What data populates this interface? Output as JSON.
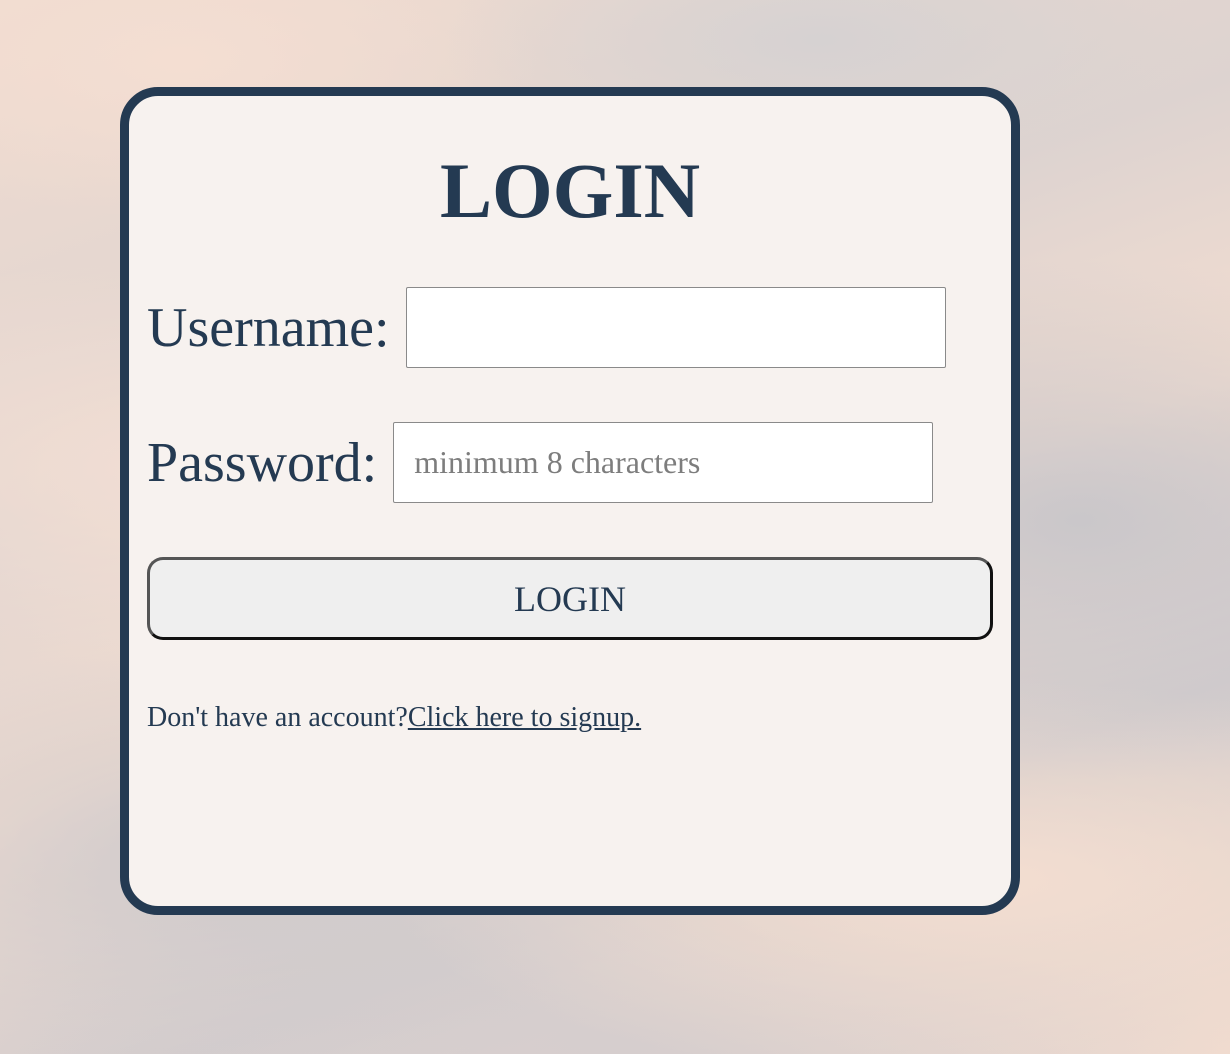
{
  "login_form": {
    "title": "LOGIN",
    "username": {
      "label": "Username:",
      "value": "",
      "placeholder": ""
    },
    "password": {
      "label": "Password:",
      "value": "",
      "placeholder": "minimum 8 characters"
    },
    "submit_label": "LOGIN",
    "signup_prompt": "Don't have an account?",
    "signup_link": "Click here to signup."
  },
  "colors": {
    "primary": "#243a52",
    "card_background": "#f7f2ef",
    "button_background": "#efefef"
  }
}
